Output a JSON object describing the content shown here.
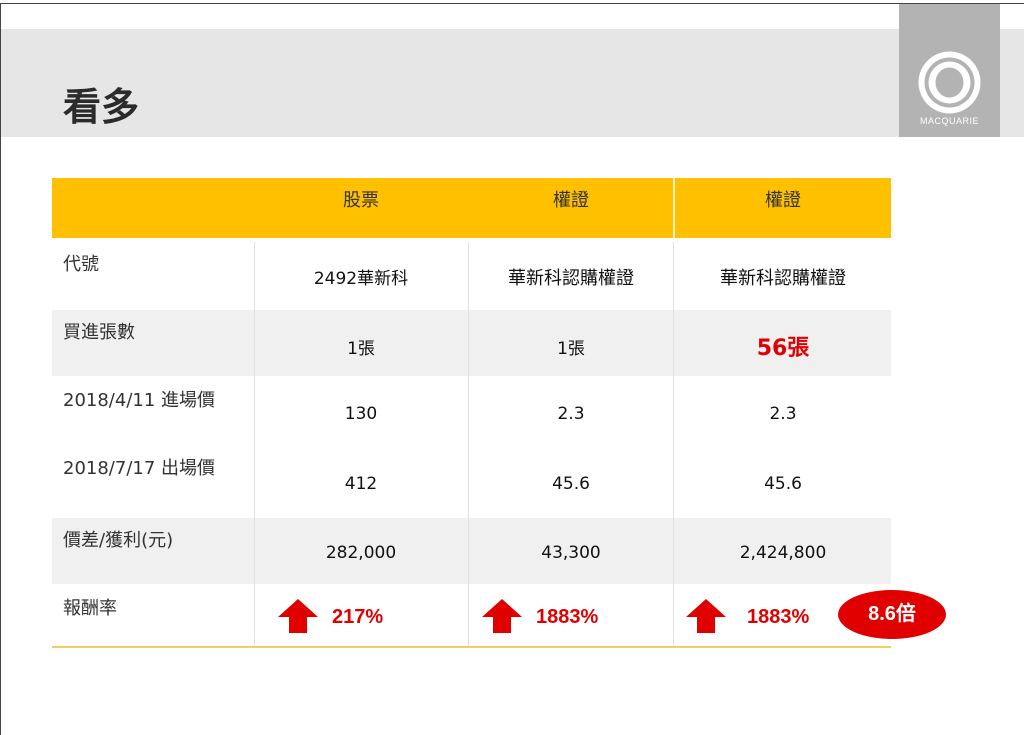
{
  "slide": {
    "title": "看多",
    "logo_text": "MACQUARIE"
  },
  "table": {
    "headers": [
      "股票",
      "權證",
      "權證"
    ],
    "rows": [
      {
        "label": "代號",
        "values": [
          "2492華新科",
          "華新科認購權證",
          "華新科認購權證"
        ]
      },
      {
        "label": "買進張數",
        "values": [
          "1張",
          "1張",
          "56張"
        ]
      },
      {
        "label": "2018/4/11 進場價",
        "values": [
          "130",
          "2.3",
          "2.3"
        ]
      },
      {
        "label": "2018/7/17 出場價",
        "values": [
          "412",
          "45.6",
          "45.6"
        ]
      },
      {
        "label": "價差/獲利(元)",
        "values": [
          "282,000",
          "43,300",
          "2,424,800"
        ]
      },
      {
        "label": "報酬率",
        "values": [
          "217%",
          "1883%",
          "1883%"
        ]
      }
    ]
  },
  "badge": {
    "text": "8.6倍"
  },
  "colors": {
    "header_band": "#e6e6e6",
    "table_header": "#ffc000",
    "accent_red": "#e00000",
    "logo_box": "#b3b3b3"
  },
  "icons": {
    "return_indicator": "red-up-arrow-icon",
    "logo": "macquarie-ring-logo-icon"
  }
}
